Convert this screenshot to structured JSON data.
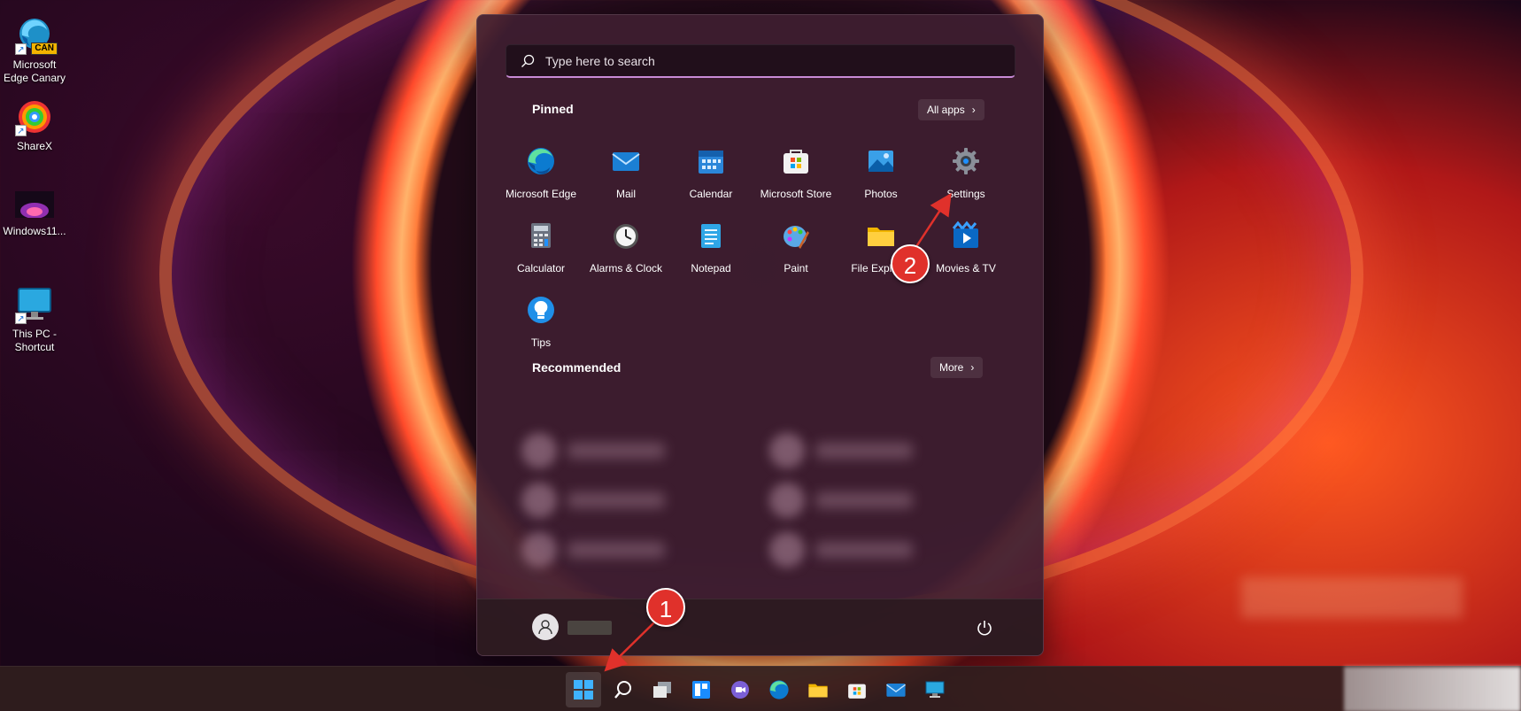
{
  "desktop": {
    "icons": [
      {
        "label": "Microsoft Edge Canary",
        "badge": "CAN",
        "icon": "edge-canary-icon"
      },
      {
        "label": "ShareX",
        "icon": "sharex-icon"
      },
      {
        "label": "Windows11...",
        "icon": "image-thumbnail-icon"
      },
      {
        "label": "This PC - Shortcut",
        "icon": "monitor-icon"
      }
    ]
  },
  "start_menu": {
    "search_placeholder": "Type here to search",
    "pinned_title": "Pinned",
    "all_apps_label": "All apps",
    "pinned_apps": [
      {
        "label": "Microsoft Edge",
        "icon": "edge-icon"
      },
      {
        "label": "Mail",
        "icon": "mail-icon"
      },
      {
        "label": "Calendar",
        "icon": "calendar-icon"
      },
      {
        "label": "Microsoft Store",
        "icon": "store-icon"
      },
      {
        "label": "Photos",
        "icon": "photos-icon"
      },
      {
        "label": "Settings",
        "icon": "gear-icon"
      },
      {
        "label": "Calculator",
        "icon": "calculator-icon"
      },
      {
        "label": "Alarms & Clock",
        "icon": "clock-icon"
      },
      {
        "label": "Notepad",
        "icon": "notepad-icon"
      },
      {
        "label": "Paint",
        "icon": "paint-icon"
      },
      {
        "label": "File Explorer",
        "icon": "folder-icon"
      },
      {
        "label": "Movies & TV",
        "icon": "movies-icon"
      },
      {
        "label": "Tips",
        "icon": "tips-icon"
      }
    ],
    "recommended_title": "Recommended",
    "more_label": "More"
  },
  "annotations": {
    "callout_1": "1",
    "callout_2": "2",
    "color": "#e0312b"
  },
  "taskbar": {
    "items": [
      "start-icon",
      "search-icon",
      "task-view-icon",
      "widgets-icon",
      "teams-chat-icon",
      "edge-icon",
      "file-explorer-icon",
      "store-icon",
      "mail-icon",
      "remote-desktop-icon"
    ]
  },
  "colors": {
    "accent": "#c88ad6",
    "start_bg": "#3e1e30",
    "taskbar_bg": "#301e1e"
  }
}
